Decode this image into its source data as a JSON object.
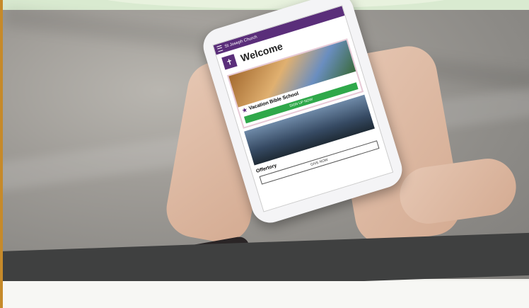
{
  "app": {
    "header_title": "St Joseph Church",
    "welcome": "Welcome",
    "cards": [
      {
        "title": "Vacation Bible School",
        "button": "SIGN UP NOW"
      },
      {
        "title": "Offertory",
        "button": "GIVE NOW"
      }
    ]
  },
  "colors": {
    "app_bar": "#5a2e7a",
    "primary_button": "#2fa84a",
    "top_strip": "#d9ead0",
    "left_border": "#c68a2a",
    "dark_band": "#3f4040"
  },
  "icons": [
    "menu-icon",
    "church-logo-icon",
    "star-icon"
  ]
}
